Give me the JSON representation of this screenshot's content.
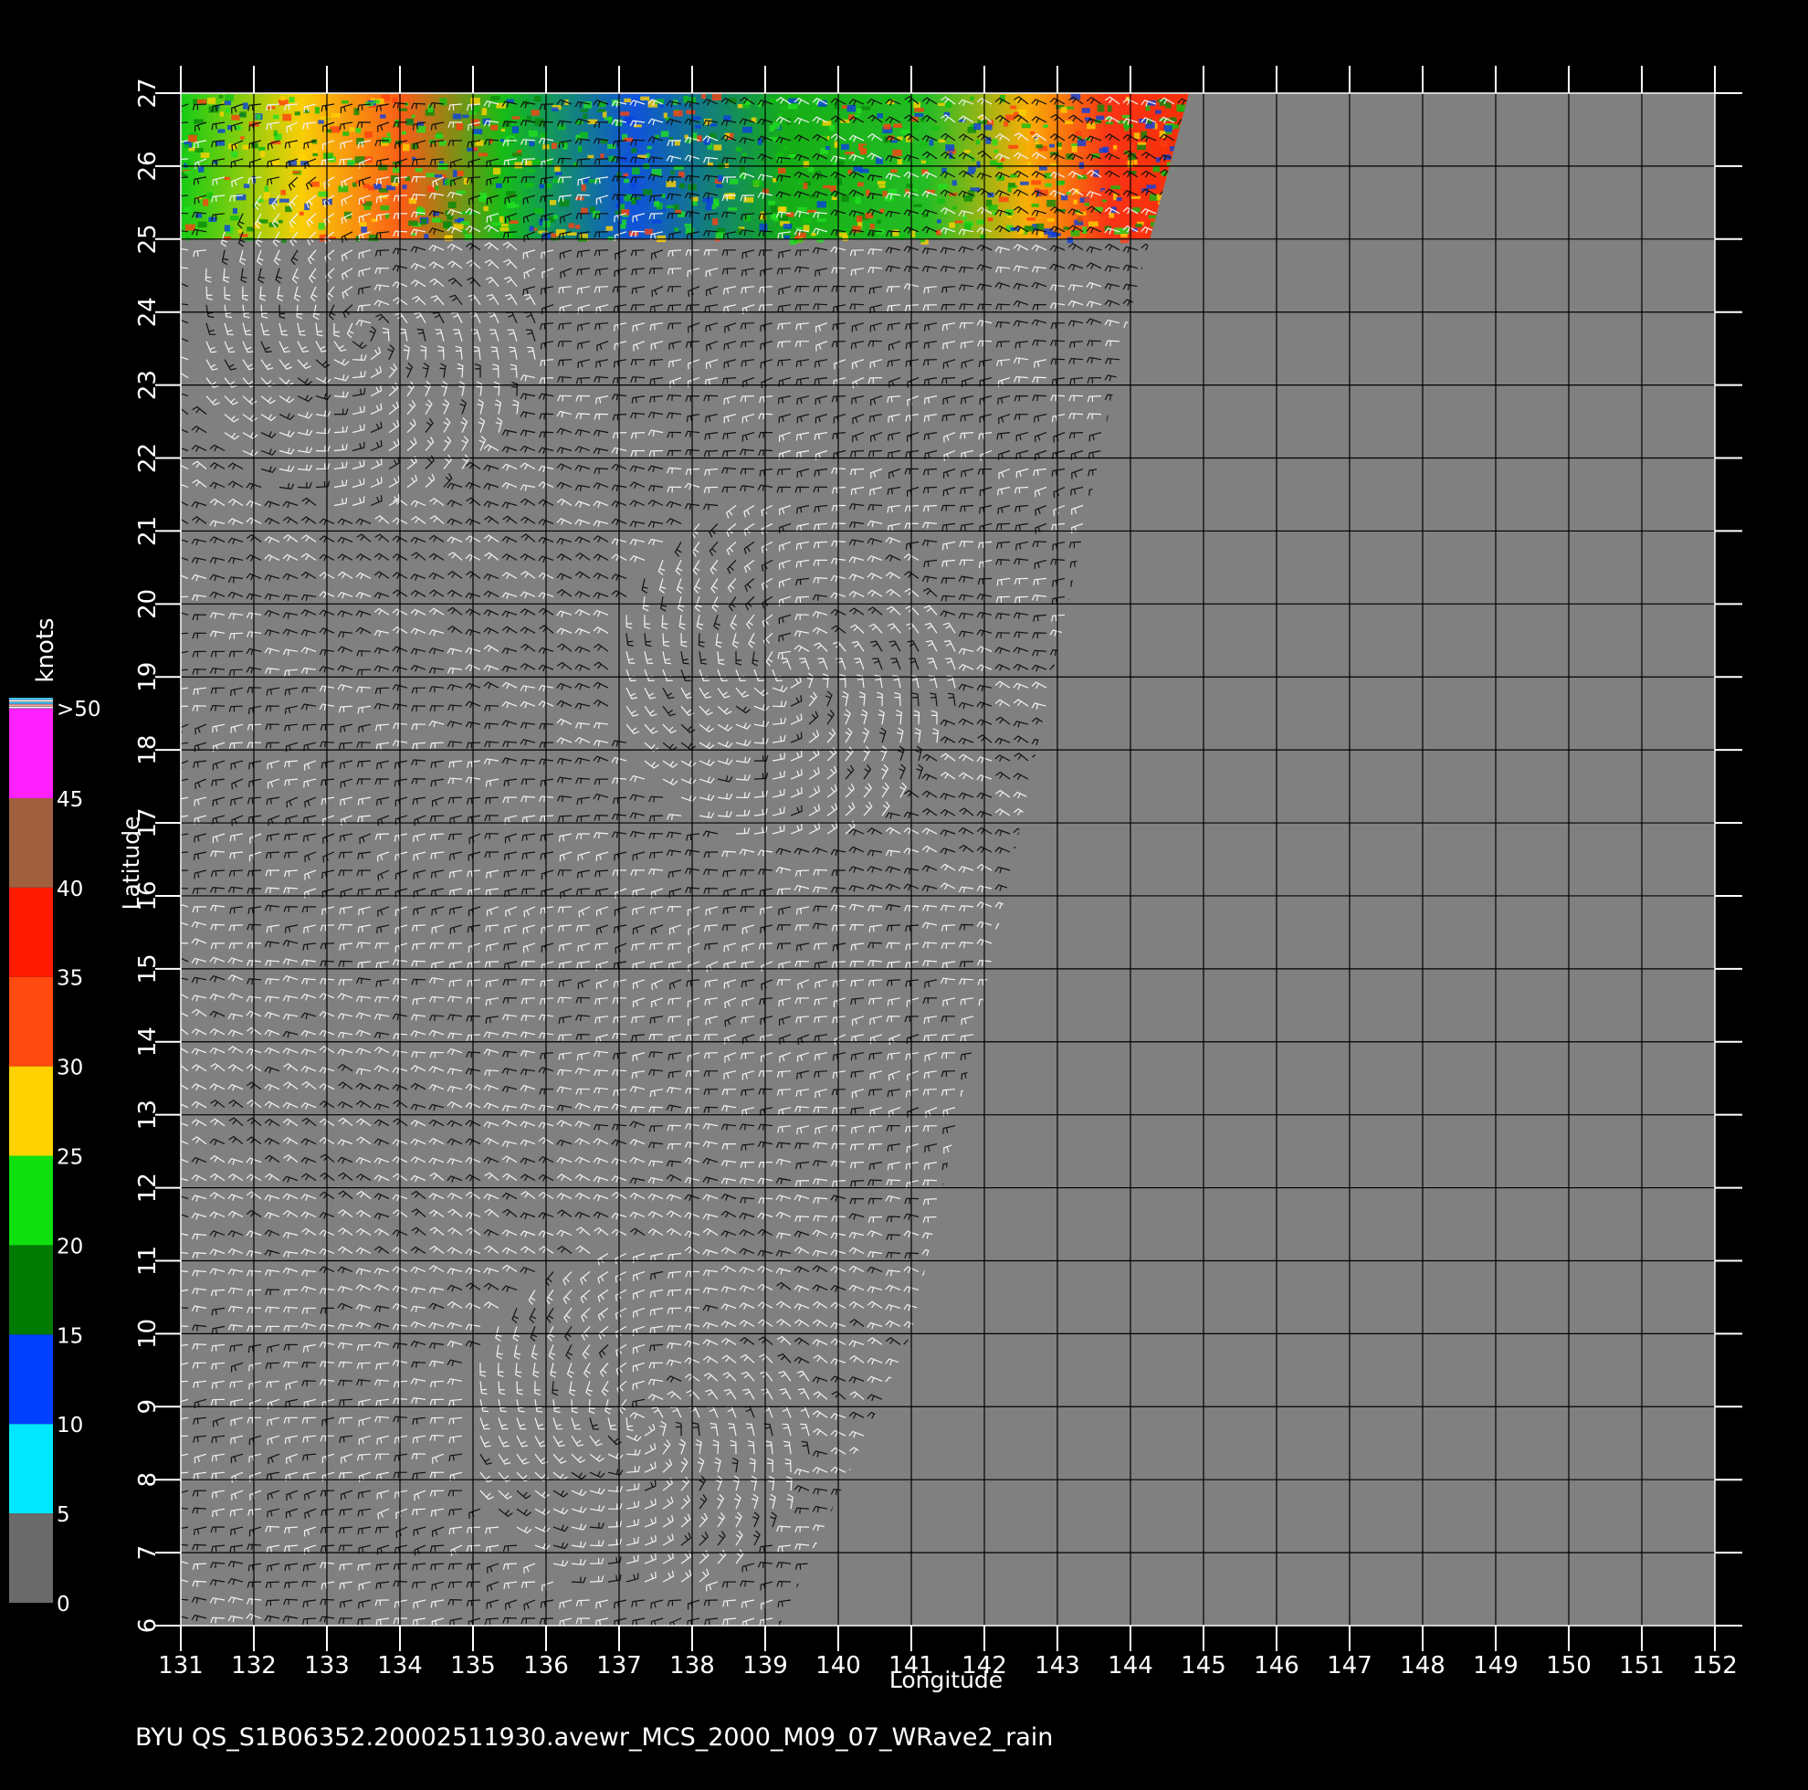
{
  "map": {
    "x_axis": {
      "label": "Longitude",
      "ticks": [
        "131",
        "132",
        "133",
        "134",
        "135",
        "136",
        "137",
        "138",
        "139",
        "140",
        "141",
        "142",
        "143",
        "144",
        "145",
        "146",
        "147",
        "148",
        "149",
        "150",
        "151",
        "152"
      ]
    },
    "y_axis": {
      "label": "Latitude",
      "ticks": [
        "6",
        "7",
        "8",
        "9",
        "10",
        "11",
        "12",
        "13",
        "14",
        "15",
        "16",
        "17",
        "18",
        "19",
        "20",
        "21",
        "22",
        "23",
        "24",
        "25",
        "26",
        "27"
      ]
    },
    "lon_range": [
      131,
      152
    ],
    "lat_range": [
      6,
      27
    ],
    "background_color": "#000000",
    "land_or_nodata_color": "#808080",
    "grid_color": "#000000",
    "swath_edge": [
      [
        131,
        6
      ],
      [
        139.2,
        6
      ],
      [
        141,
        10
      ],
      [
        144,
        24
      ],
      [
        144.8,
        27
      ],
      [
        131,
        27
      ]
    ],
    "rain_band": {
      "lat_range": [
        25,
        27
      ],
      "lon_range": [
        131,
        144.8
      ]
    },
    "cyclone_centers": [
      [
        133.5,
        23.7
      ],
      [
        139.3,
        19.1
      ],
      [
        137.3,
        8.8
      ]
    ],
    "footer": "BYU  QS_S1B06352.20002511930.avewr_MCS_2000_M09_07_WRave2_rain"
  },
  "legend": {
    "title": "knots",
    "labels": [
      ">50",
      "45",
      "40",
      "35",
      "30",
      "25",
      "20",
      "15",
      "10",
      "5",
      "0"
    ],
    "values": [
      50,
      45,
      40,
      35,
      30,
      25,
      20,
      15,
      10,
      5,
      0
    ],
    "colors": {
      "0": "#6a6a6a",
      "5": "#00e8ff",
      "10": "#0040ff",
      "15": "#007a00",
      "20": "#10e010",
      "25": "#ffd200",
      "30": "#ff4a10",
      "35": "#ff1a00",
      "40": "#a06040",
      "45": "#ff20ff",
      "50": "#8010c0"
    }
  }
}
